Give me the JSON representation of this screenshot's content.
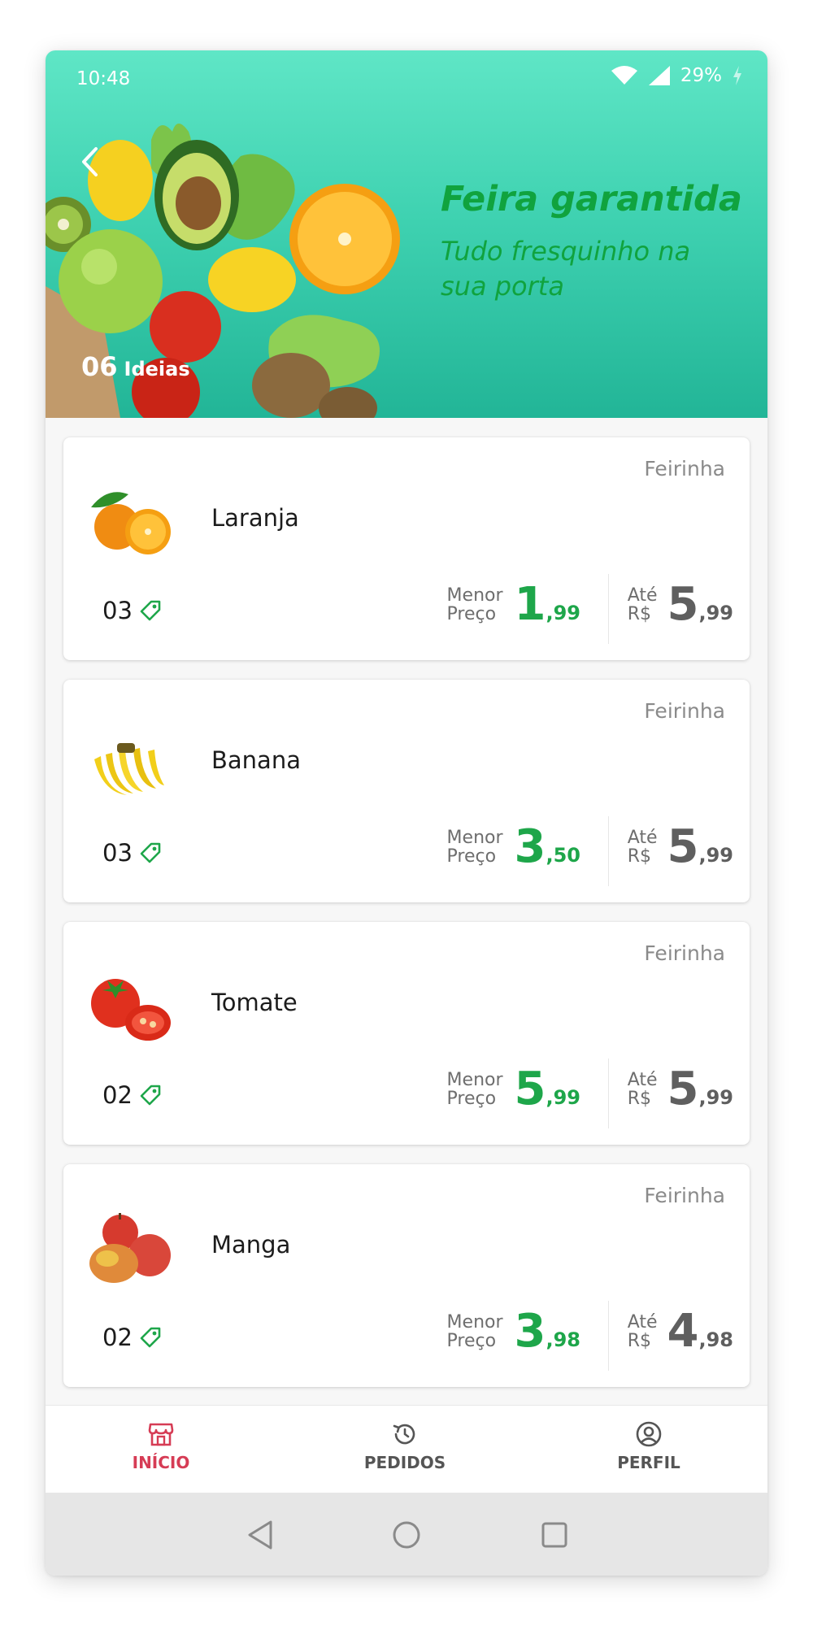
{
  "status_bar": {
    "time": "10:48",
    "battery": "29%"
  },
  "hero": {
    "title": "Feira garantida",
    "subtitle": "Tudo fresquinho na sua porta",
    "ideas_count": "06",
    "ideas_label": "Ideias"
  },
  "products": [
    {
      "name": "Laranja",
      "store": "Feirinha",
      "offers": "03",
      "low_label_1": "Menor",
      "low_label_2": "Preço",
      "low_int": "1",
      "low_dec": ",99",
      "high_label_1": "Até",
      "high_label_2": "R$",
      "high_int": "5",
      "high_dec": ",99"
    },
    {
      "name": "Banana",
      "store": "Feirinha",
      "offers": "03",
      "low_label_1": "Menor",
      "low_label_2": "Preço",
      "low_int": "3",
      "low_dec": ",50",
      "high_label_1": "Até",
      "high_label_2": "R$",
      "high_int": "5",
      "high_dec": ",99"
    },
    {
      "name": "Tomate",
      "store": "Feirinha",
      "offers": "02",
      "low_label_1": "Menor",
      "low_label_2": "Preço",
      "low_int": "5",
      "low_dec": ",99",
      "high_label_1": "Até",
      "high_label_2": "R$",
      "high_int": "5",
      "high_dec": ",99"
    },
    {
      "name": "Manga",
      "store": "Feirinha",
      "offers": "02",
      "low_label_1": "Menor",
      "low_label_2": "Preço",
      "low_int": "3",
      "low_dec": ",98",
      "high_label_1": "Até",
      "high_label_2": "R$",
      "high_int": "4",
      "high_dec": ",98"
    }
  ],
  "bottom_nav": [
    {
      "label": "INÍCIO",
      "icon": "store-icon",
      "active": true
    },
    {
      "label": "PEDIDOS",
      "icon": "history-icon",
      "active": false
    },
    {
      "label": "PERFIL",
      "icon": "user-circle-icon",
      "active": false
    }
  ],
  "colors": {
    "accent_green": "#1ea64a",
    "active_nav": "#d63c55",
    "hero_bg": "#3fd2b1"
  }
}
